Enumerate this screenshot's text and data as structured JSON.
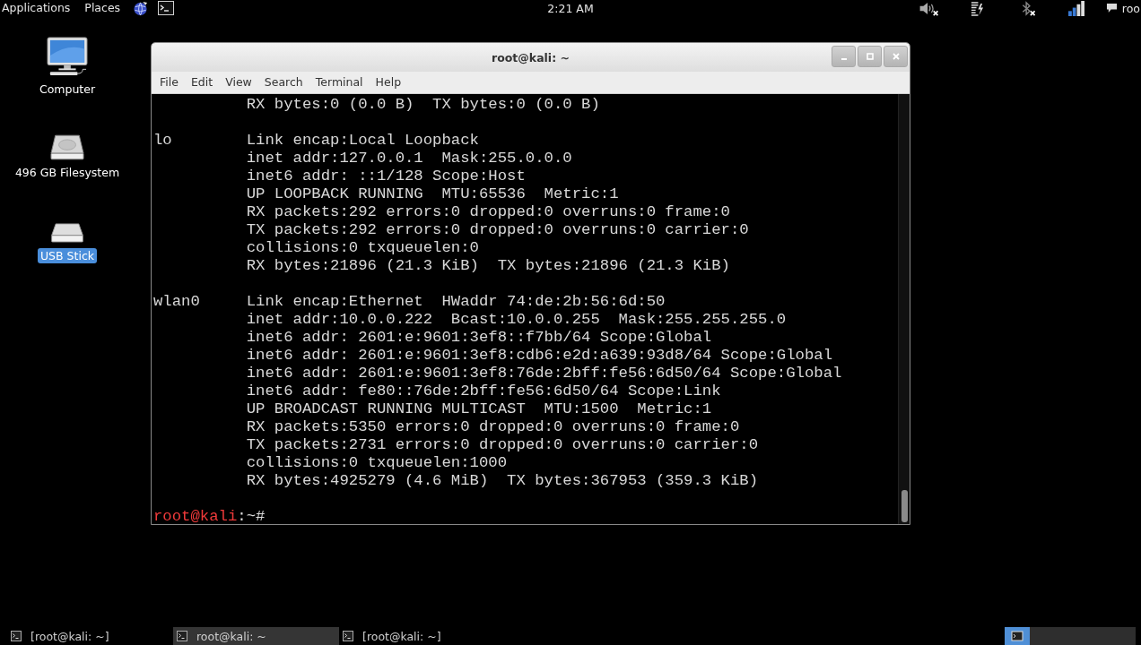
{
  "top_panel": {
    "menus": [
      "Applications",
      "Places"
    ],
    "clock": "2:21 AM",
    "user": "roo"
  },
  "desktop_icons": [
    {
      "kind": "computer",
      "label": "Computer",
      "selected": false
    },
    {
      "kind": "drive",
      "label": "496 GB Filesystem",
      "selected": false
    },
    {
      "kind": "usb",
      "label": "USB Stick",
      "selected": true
    }
  ],
  "terminal_window": {
    "title": "root@kali: ~",
    "menu": [
      "File",
      "Edit",
      "View",
      "Search",
      "Terminal",
      "Help"
    ],
    "output_blocks": [
      {
        "lines": [
          "RX bytes:0 (0.0 B)  TX bytes:0 (0.0 B)"
        ]
      },
      {
        "interface": "lo",
        "lines": [
          "Link encap:Local Loopback",
          "inet addr:127.0.0.1  Mask:255.0.0.0",
          "inet6 addr: ::1/128 Scope:Host",
          "UP LOOPBACK RUNNING  MTU:65536  Metric:1",
          "RX packets:292 errors:0 dropped:0 overruns:0 frame:0",
          "TX packets:292 errors:0 dropped:0 overruns:0 carrier:0",
          "collisions:0 txqueuelen:0",
          "RX bytes:21896 (21.3 KiB)  TX bytes:21896 (21.3 KiB)"
        ]
      },
      {
        "interface": "wlan0",
        "lines": [
          "Link encap:Ethernet  HWaddr 74:de:2b:56:6d:50",
          "inet addr:10.0.0.222  Bcast:10.0.0.255  Mask:255.255.255.0",
          "inet6 addr: 2601:e:9601:3ef8::f7bb/64 Scope:Global",
          "inet6 addr: 2601:e:9601:3ef8:cdb6:e2d:a639:93d8/64 Scope:Global",
          "inet6 addr: 2601:e:9601:3ef8:76de:2bff:fe56:6d50/64 Scope:Global",
          "inet6 addr: fe80::76de:2bff:fe56:6d50/64 Scope:Link",
          "UP BROADCAST RUNNING MULTICAST  MTU:1500  Metric:1",
          "RX packets:5350 errors:0 dropped:0 overruns:0 frame:0",
          "TX packets:2731 errors:0 dropped:0 overruns:0 carrier:0",
          "collisions:0 txqueuelen:1000",
          "RX bytes:4925279 (4.6 MiB)  TX bytes:367953 (359.3 KiB)"
        ]
      }
    ],
    "prompt": {
      "user_host": "root@kali",
      "suffix": ":~#"
    }
  },
  "taskbar": {
    "items": [
      {
        "label": "[root@kali: ~]",
        "selected": false
      },
      {
        "label": "root@kali: ~",
        "selected": true
      },
      {
        "label": "[root@kali: ~]",
        "selected": false
      }
    ]
  }
}
